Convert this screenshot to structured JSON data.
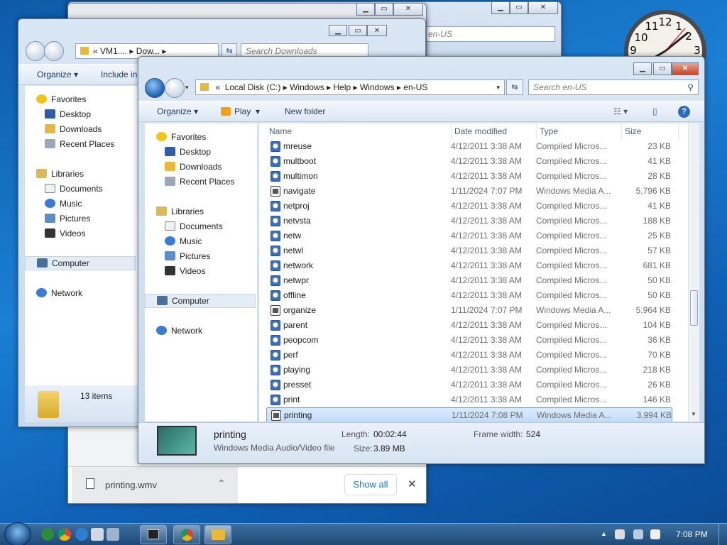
{
  "clock": {
    "numerals": [
      "12",
      "1",
      "2",
      "3",
      "9",
      "10",
      "11"
    ]
  },
  "back_window": {
    "search_fragment": "en-US"
  },
  "downloads_window": {
    "address": [
      "VM1....",
      "Dow..."
    ],
    "search_placeholder": "Search Downloads",
    "toolbar": {
      "organize": "Organize",
      "include": "Include in"
    },
    "nav": {
      "favorites": "Favorites",
      "desktop": "Desktop",
      "downloads": "Downloads",
      "recent": "Recent Places",
      "libraries": "Libraries",
      "documents": "Documents",
      "music": "Music",
      "pictures": "Pictures",
      "videos": "Videos",
      "computer": "Computer",
      "network": "Network"
    },
    "status": "13 items"
  },
  "download_bar": {
    "filename": "printing.wmv",
    "show_all": "Show all",
    "close_glyph": "✕",
    "chevron_glyph": "⌃"
  },
  "main_window": {
    "address_prefix": "«",
    "breadcrumb": [
      "Local Disk (C:)",
      "Windows",
      "Help",
      "Windows",
      "en-US"
    ],
    "search_placeholder": "Search en-US",
    "toolbar": {
      "organize": "Organize",
      "play": "Play",
      "new_folder": "New folder"
    },
    "nav": {
      "favorites": "Favorites",
      "desktop": "Desktop",
      "downloads": "Downloads",
      "recent": "Recent Places",
      "libraries": "Libraries",
      "documents": "Documents",
      "music": "Music",
      "pictures": "Pictures",
      "videos": "Videos",
      "computer": "Computer",
      "network": "Network"
    },
    "columns": {
      "name": "Name",
      "date": "Date modified",
      "type": "Type",
      "size": "Size"
    },
    "files": [
      {
        "name": "mreuse",
        "date": "4/12/2011 3:38 AM",
        "type": "Compiled Micros...",
        "size": "23 KB",
        "icon": "chm"
      },
      {
        "name": "multboot",
        "date": "4/12/2011 3:38 AM",
        "type": "Compiled Micros...",
        "size": "41 KB",
        "icon": "chm"
      },
      {
        "name": "multimon",
        "date": "4/12/2011 3:38 AM",
        "type": "Compiled Micros...",
        "size": "28 KB",
        "icon": "chm"
      },
      {
        "name": "navigate",
        "date": "1/11/2024 7:07 PM",
        "type": "Windows Media A...",
        "size": "5,796 KB",
        "icon": "wmv"
      },
      {
        "name": "netproj",
        "date": "4/12/2011 3:38 AM",
        "type": "Compiled Micros...",
        "size": "41 KB",
        "icon": "chm"
      },
      {
        "name": "netvsta",
        "date": "4/12/2011 3:38 AM",
        "type": "Compiled Micros...",
        "size": "188 KB",
        "icon": "chm"
      },
      {
        "name": "netw",
        "date": "4/12/2011 3:38 AM",
        "type": "Compiled Micros...",
        "size": "25 KB",
        "icon": "chm"
      },
      {
        "name": "netwl",
        "date": "4/12/2011 3:38 AM",
        "type": "Compiled Micros...",
        "size": "57 KB",
        "icon": "chm"
      },
      {
        "name": "network",
        "date": "4/12/2011 3:38 AM",
        "type": "Compiled Micros...",
        "size": "681 KB",
        "icon": "chm"
      },
      {
        "name": "netwpr",
        "date": "4/12/2011 3:38 AM",
        "type": "Compiled Micros...",
        "size": "50 KB",
        "icon": "chm"
      },
      {
        "name": "offline",
        "date": "4/12/2011 3:38 AM",
        "type": "Compiled Micros...",
        "size": "50 KB",
        "icon": "chm"
      },
      {
        "name": "organize",
        "date": "1/11/2024 7:07 PM",
        "type": "Windows Media A...",
        "size": "5,964 KB",
        "icon": "wmv"
      },
      {
        "name": "parent",
        "date": "4/12/2011 3:38 AM",
        "type": "Compiled Micros...",
        "size": "104 KB",
        "icon": "chm"
      },
      {
        "name": "peopcom",
        "date": "4/12/2011 3:38 AM",
        "type": "Compiled Micros...",
        "size": "36 KB",
        "icon": "chm"
      },
      {
        "name": "perf",
        "date": "4/12/2011 3:38 AM",
        "type": "Compiled Micros...",
        "size": "70 KB",
        "icon": "chm"
      },
      {
        "name": "playing",
        "date": "4/12/2011 3:38 AM",
        "type": "Compiled Micros...",
        "size": "218 KB",
        "icon": "chm"
      },
      {
        "name": "presset",
        "date": "4/12/2011 3:38 AM",
        "type": "Compiled Micros...",
        "size": "26 KB",
        "icon": "chm"
      },
      {
        "name": "print",
        "date": "4/12/2011 3:38 AM",
        "type": "Compiled Micros...",
        "size": "146 KB",
        "icon": "chm"
      },
      {
        "name": "printing",
        "date": "1/11/2024 7:08 PM",
        "type": "Windows Media A...",
        "size": "3,994 KB",
        "icon": "wmv",
        "selected": true
      }
    ],
    "details": {
      "name": "printing",
      "kind": "Windows Media Audio/Video file",
      "length_label": "Length:",
      "length": "00:02:44",
      "size_label": "Size:",
      "size": "3.89 MB",
      "frame_label": "Frame width:",
      "frame": "524"
    }
  },
  "taskbar": {
    "time": "7:08 PM"
  },
  "colors": {
    "selection": "#c2dcfb",
    "accent": "#1f5fae",
    "close": "#c7432a"
  }
}
